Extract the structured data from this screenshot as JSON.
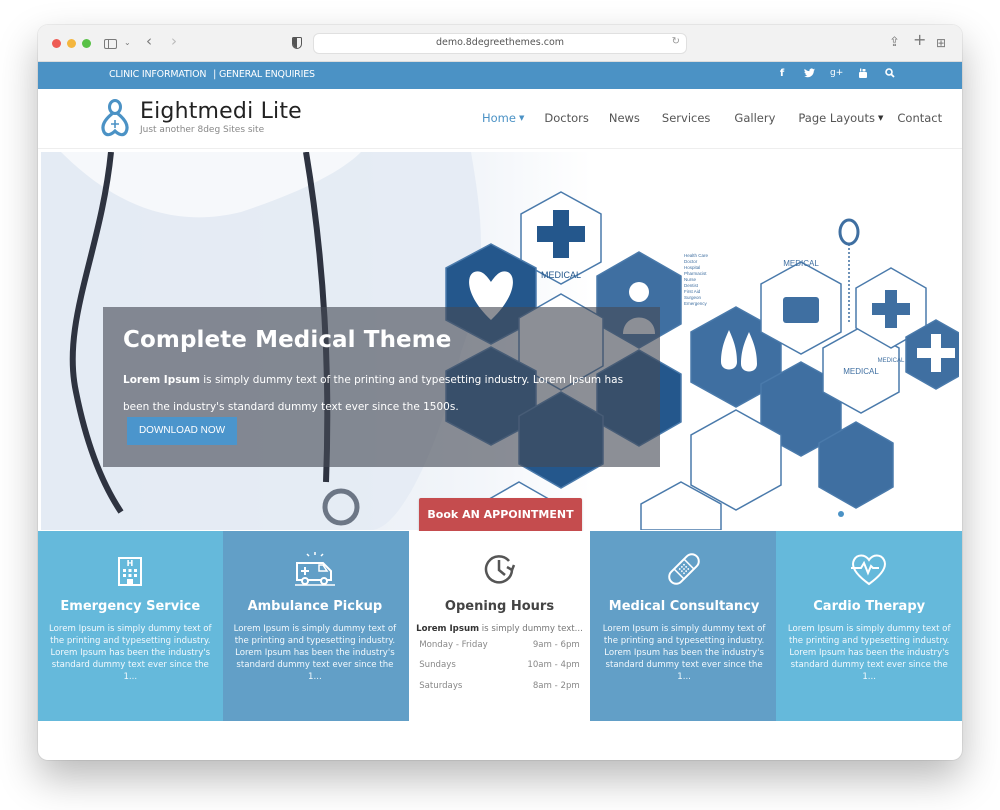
{
  "browser": {
    "url": "demo.8degreethemes.com",
    "icons": [
      "sidebar-toggle-icon",
      "chevron-down-icon",
      "back-icon",
      "forward-icon",
      "privacy-shield-icon",
      "reload-icon",
      "share-icon",
      "new-tab-icon",
      "tab-overview-icon"
    ]
  },
  "topbar": {
    "links": [
      {
        "label": "CLINIC INFORMATION"
      },
      {
        "label": "| GENERAL ENQUIRIES"
      }
    ],
    "social": [
      {
        "name": "facebook-icon",
        "glyph": "f"
      },
      {
        "name": "twitter-icon",
        "glyph": "🐦"
      },
      {
        "name": "google-plus-icon",
        "glyph": "g+"
      },
      {
        "name": "youtube-icon",
        "glyph": "▶"
      },
      {
        "name": "search-icon",
        "glyph": "⌕"
      }
    ],
    "color": "#4b92c5"
  },
  "header": {
    "title": "Eightmedi Lite",
    "tagline": "Just another 8deg Sites site",
    "nav": [
      {
        "label": "Home",
        "dropdown": true,
        "active": true
      },
      {
        "label": "Doctors",
        "dropdown": false,
        "active": false
      },
      {
        "label": "News",
        "dropdown": false,
        "active": false
      },
      {
        "label": "Services",
        "dropdown": false,
        "active": false
      },
      {
        "label": "Gallery",
        "dropdown": false,
        "active": false
      },
      {
        "label": "Page Layouts",
        "dropdown": true,
        "active": false
      },
      {
        "label": "Contact",
        "dropdown": false,
        "active": false
      }
    ],
    "caret": "▼"
  },
  "hero": {
    "title": "Complete Medical Theme",
    "text_bold": "Lorem Ipsum",
    "text_rest": " is simply dummy text of the printing and typesetting industry. Lorem Ipsum has been the industry's standard dummy text ever since the 1500s.",
    "button": "DOWNLOAD NOW",
    "art_labels": {
      "medical": "MEDICAL",
      "list": [
        "Health Care",
        "Doctor",
        "Hospital",
        "Pharmacist",
        "Nurse",
        "Dentist",
        "First Aid",
        "Surgeon",
        "Emergency"
      ]
    }
  },
  "appointment": {
    "label": "Book AN APPOINTMENT",
    "color": "#c54c4e"
  },
  "services": [
    {
      "title": "Emergency Service",
      "icon": "hospital-icon",
      "text": "Lorem Ipsum is simply dummy text of the printing and typesetting industry. Lorem Ipsum has been the industry's standard dummy text ever since the 1..."
    },
    {
      "title": "Ambulance Pickup",
      "icon": "ambulance-icon",
      "text": "Lorem Ipsum is simply dummy text of the printing and typesetting industry. Lorem Ipsum has been the industry's standard dummy text ever since the 1..."
    },
    {
      "title": "Opening Hours",
      "icon": "clock-icon",
      "intro_bold": "Lorem Ipsum",
      "intro_rest": " is simply dummy text...",
      "hours": [
        {
          "day": "Monday - Friday",
          "time": "9am - 6pm"
        },
        {
          "day": "Sundays",
          "time": "10am - 4pm"
        },
        {
          "day": "Saturdays",
          "time": "8am - 2pm"
        }
      ]
    },
    {
      "title": "Medical Consultancy",
      "icon": "bandage-icon",
      "text": "Lorem Ipsum is simply dummy text of the printing and typesetting industry. Lorem Ipsum has been the industry's standard dummy text ever since the 1..."
    },
    {
      "title": "Cardio Therapy",
      "icon": "heartbeat-icon",
      "text": "Lorem Ipsum is simply dummy text of the printing and typesetting industry. Lorem Ipsum has been the industry's standard dummy text ever since the 1..."
    }
  ]
}
